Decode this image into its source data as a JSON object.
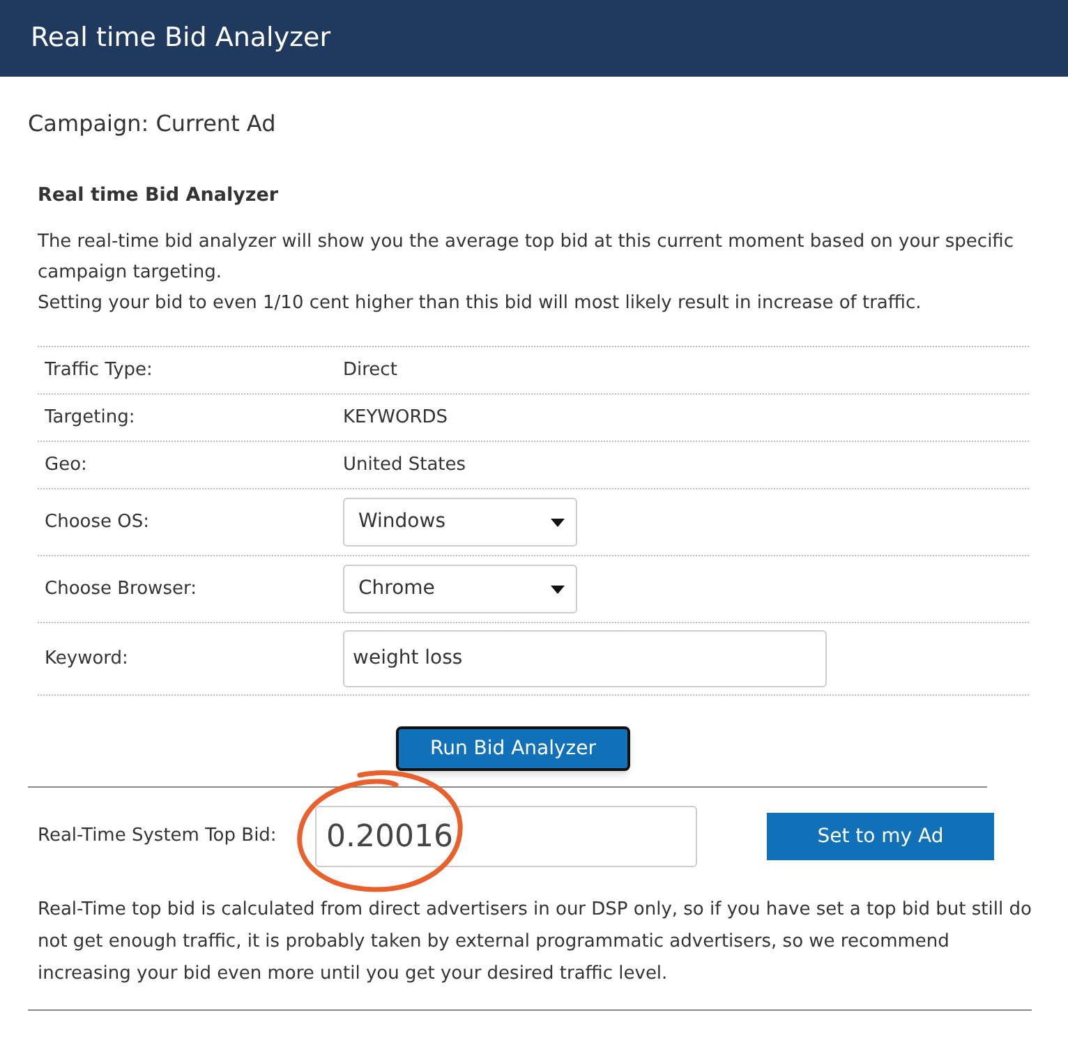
{
  "header": {
    "title": "Real time Bid Analyzer"
  },
  "campaign": {
    "title": "Campaign: Current Ad"
  },
  "section": {
    "heading": "Real time Bid Analyzer",
    "description": [
      "The real-time bid analyzer will show you the average top bid at this current moment based on your specific campaign targeting.",
      "Setting your bid to even 1/10 cent higher than this bid will most likely result in increase of traffic."
    ]
  },
  "rows": [
    {
      "kind": "text",
      "label": "Traffic Type:",
      "value": "Direct"
    },
    {
      "kind": "text",
      "label": "Targeting:",
      "value": "KEYWORDS"
    },
    {
      "kind": "text",
      "label": "Geo:",
      "value": "United States"
    },
    {
      "kind": "select",
      "label": "Choose OS:",
      "value": "Windows"
    },
    {
      "kind": "select",
      "label": "Choose Browser:",
      "value": "Chrome"
    },
    {
      "kind": "input",
      "label": "Keyword:",
      "value": "weight loss"
    }
  ],
  "run_button": "Run Bid Analyzer",
  "top_bid": {
    "label": "Real-Time System Top Bid:",
    "value": "0.20016",
    "circled": true,
    "button": "Set to my Ad"
  },
  "note": "Real-Time top bid is calculated from direct advertisers in our DSP only, so if you have set a top bid but still do not get enough traffic, it is probably taken by external programmatic advertisers, so we recommend increasing your bid even more until you get your desired traffic level."
}
